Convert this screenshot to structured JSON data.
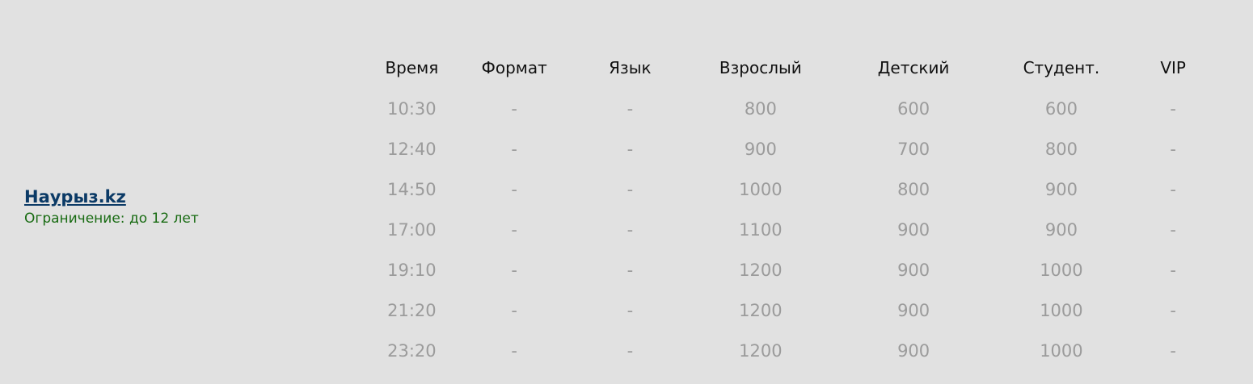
{
  "movie": {
    "title": "Наурыз.kz",
    "restriction": "Ограничение: до 12 лет"
  },
  "schedule": {
    "headers": [
      "Время",
      "Формат",
      "Язык",
      "Взрослый",
      "Детский",
      "Студент.",
      "VIP"
    ],
    "rows": [
      [
        "10:30",
        "-",
        "-",
        "800",
        "600",
        "600",
        "-"
      ],
      [
        "12:40",
        "-",
        "-",
        "900",
        "700",
        "800",
        "-"
      ],
      [
        "14:50",
        "-",
        "-",
        "1000",
        "800",
        "900",
        "-"
      ],
      [
        "17:00",
        "-",
        "-",
        "1100",
        "900",
        "900",
        "-"
      ],
      [
        "19:10",
        "-",
        "-",
        "1200",
        "900",
        "1000",
        "-"
      ],
      [
        "21:20",
        "-",
        "-",
        "1200",
        "900",
        "1000",
        "-"
      ],
      [
        "23:20",
        "-",
        "-",
        "1200",
        "900",
        "1000",
        "-"
      ]
    ]
  },
  "colors": {
    "background": "#e1e1e1",
    "title_link": "#0b3a66",
    "restriction_text": "#186b12",
    "header_text": "#111111",
    "cell_text": "#9b9b9b"
  }
}
